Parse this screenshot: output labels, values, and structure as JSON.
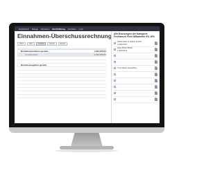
{
  "nav": {
    "items": [
      "Dashboard",
      "Belege",
      "Finanzen",
      "Buchhaltung",
      "Kontakte",
      "Lohn"
    ],
    "active_index": 3
  },
  "page": {
    "title": "Einnahmen-Überschussrechnung"
  },
  "toolbar": {
    "buttons": [
      "2021",
      "Jahr",
      "Quartal",
      "Monat",
      "Export"
    ]
  },
  "report": {
    "rows": [
      {
        "label": "Betriebseinnahmen gesamt",
        "value": "1.224.970,61",
        "type": "bold"
      },
      {
        "label": "Umsatzerlöse",
        "value": "1.224.970,61",
        "type": "sub selected"
      },
      {
        "label": "",
        "value": "",
        "type": "sub"
      },
      {
        "label": "",
        "value": "",
        "type": "sub"
      },
      {
        "label": "Betriebsausgaben gesamt",
        "value": "-",
        "type": "bold"
      },
      {
        "label": "",
        "value": "",
        "type": "sub"
      },
      {
        "label": "",
        "value": "",
        "type": "sub"
      },
      {
        "label": "",
        "value": "",
        "type": "sub"
      },
      {
        "label": "",
        "value": "",
        "type": "sub"
      },
      {
        "label": "",
        "value": "",
        "type": "sub"
      },
      {
        "label": "",
        "value": "",
        "type": "sub"
      },
      {
        "label": "",
        "value": "",
        "type": "sub"
      },
      {
        "label": "",
        "value": "",
        "type": "sub"
      },
      {
        "label": "",
        "value": "",
        "type": "sub"
      }
    ]
  },
  "side": {
    "title": "Alle Buchungen der Kategorie Freelancer/ Freie Mitarbeiter 5% 16%",
    "bookings": [
      {
        "name": "Hotels Haus & Garten GmbH",
        "date": "",
        "amount": "1.000,00 €"
      },
      {
        "name": "Hans Mieter Bistro",
        "date": "",
        "amount": "1.000,00 €"
      },
      {
        "name": "",
        "date": "",
        "amount": ""
      },
      {
        "name": "",
        "date": "",
        "amount": ""
      },
      {
        "name": "Timo Mertin Consulting",
        "date": "",
        "amount": ""
      },
      {
        "name": "",
        "date": "",
        "amount": ""
      },
      {
        "name": "",
        "date": "",
        "amount": ""
      },
      {
        "name": "",
        "date": "",
        "amount": ""
      },
      {
        "name": "",
        "date": "",
        "amount": ""
      },
      {
        "name": "",
        "date": "",
        "amount": ""
      }
    ]
  }
}
